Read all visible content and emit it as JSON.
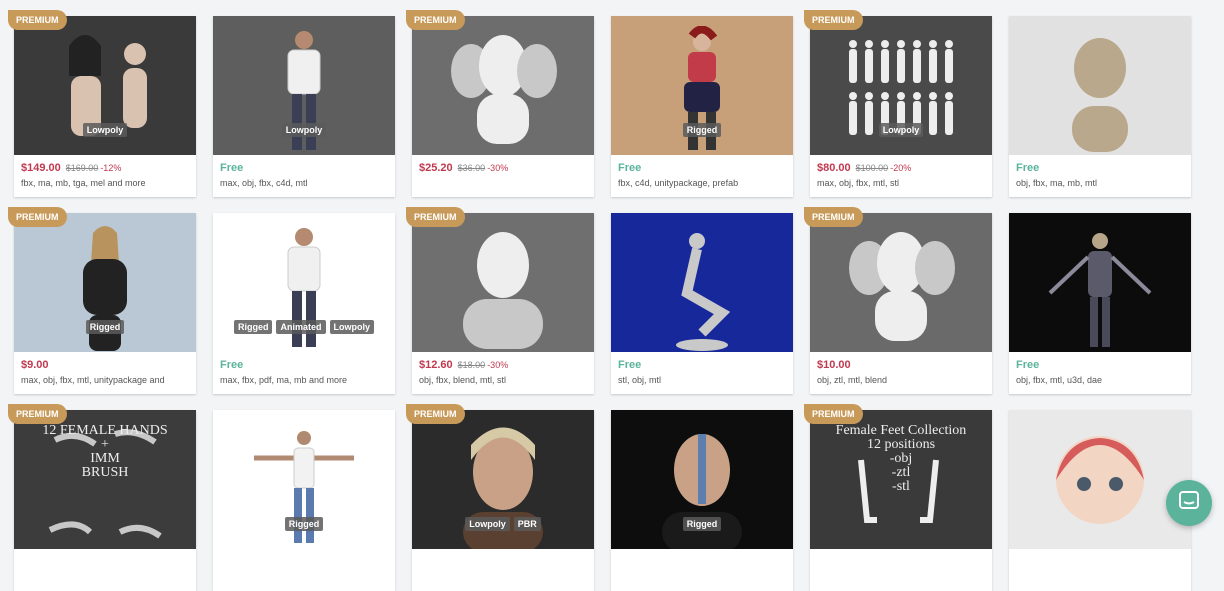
{
  "premium_label": "PREMIUM",
  "colors": {
    "background": "#f2f4f6",
    "premium": "#c89a5a",
    "paid_price": "#c0394f",
    "free_price": "#5bb39b",
    "chat_button": "#5bb39b"
  },
  "products": [
    {
      "premium": true,
      "price": "$149.00",
      "old_price": "$169.00",
      "discount": "-12%",
      "formats": "fbx, ma, mb, tga, mel and more",
      "badges": [
        "Lowpoly"
      ],
      "bg": "#3a3a3a",
      "art": "figure-light"
    },
    {
      "premium": false,
      "price": "Free",
      "formats": "max, obj, fbx, c4d, mtl",
      "badges": [
        "Lowpoly"
      ],
      "bg": "#5e5e5e",
      "art": "figure-standing"
    },
    {
      "premium": true,
      "price": "$25.20",
      "old_price": "$36.00",
      "discount": "-30%",
      "formats": "",
      "badges": [],
      "bg": "#6d6d6d",
      "art": "heads"
    },
    {
      "premium": false,
      "price": "Free",
      "formats": "fbx, c4d, unitypackage, prefab",
      "badges": [
        "Rigged"
      ],
      "bg": "#c7a07a",
      "art": "figure-red"
    },
    {
      "premium": true,
      "price": "$80.00",
      "old_price": "$100.00",
      "discount": "-20%",
      "formats": "max, obj, fbx, mtl, stl",
      "badges": [
        "Lowpoly"
      ],
      "bg": "#4a4a4a",
      "art": "crowd"
    },
    {
      "premium": false,
      "price": "Free",
      "formats": "obj, fbx, ma, mb, mtl",
      "badges": [],
      "bg": "#e1e1e1",
      "art": "bust"
    },
    {
      "premium": true,
      "price": "$9.00",
      "formats": "max, obj, fbx, mtl, unitypackage and",
      "badges": [
        "Rigged"
      ],
      "bg": "#b9c8d4",
      "art": "figure-dark"
    },
    {
      "premium": false,
      "price": "Free",
      "formats": "max, fbx, pdf, ma, mb and more",
      "badges": [
        "Rigged",
        "Animated",
        "Lowpoly"
      ],
      "bg": "#ffffff",
      "art": "figure-standing"
    },
    {
      "premium": true,
      "price": "$12.60",
      "old_price": "$18.00",
      "discount": "-30%",
      "formats": "obj, fbx, blend, mtl, stl",
      "badges": [],
      "bg": "#6f6f6f",
      "art": "head"
    },
    {
      "premium": false,
      "price": "Free",
      "formats": "stl, obj, mtl",
      "badges": [],
      "bg": "#17299a",
      "art": "statue"
    },
    {
      "premium": true,
      "price": "$10.00",
      "formats": "obj, ztl, mtl, blend",
      "badges": [],
      "bg": "#6a6a6a",
      "art": "heads"
    },
    {
      "premium": false,
      "price": "Free",
      "formats": "obj, fbx, mtl, u3d, dae",
      "badges": [],
      "bg": "#0c0c0c",
      "art": "warrior"
    },
    {
      "premium": true,
      "price": "",
      "formats": "",
      "badges": [],
      "bg": "#3c3c3c",
      "art": "hands",
      "overlay": "12 FEMALE HANDS\n+\nIMM\nBRUSH"
    },
    {
      "premium": false,
      "price": "",
      "formats": "",
      "badges": [
        "Rigged"
      ],
      "bg": "#ffffff",
      "art": "tpose"
    },
    {
      "premium": true,
      "price": "",
      "formats": "",
      "badges": [
        "Lowpoly",
        "PBR"
      ],
      "bg": "#2b2b2b",
      "art": "portrait"
    },
    {
      "premium": false,
      "price": "",
      "formats": "",
      "badges": [
        "Rigged"
      ],
      "bg": "#0d0d0d",
      "art": "cyborg"
    },
    {
      "premium": true,
      "price": "",
      "formats": "",
      "badges": [],
      "bg": "#3a3a3a",
      "art": "feet",
      "overlay": "Female Feet Collection\n12 positions\n-obj\n-ztl\n-stl"
    },
    {
      "premium": false,
      "price": "",
      "formats": "",
      "badges": [],
      "bg": "#e9e9e9",
      "art": "cartoon"
    }
  ],
  "chat": {
    "icon": "chat-icon"
  }
}
